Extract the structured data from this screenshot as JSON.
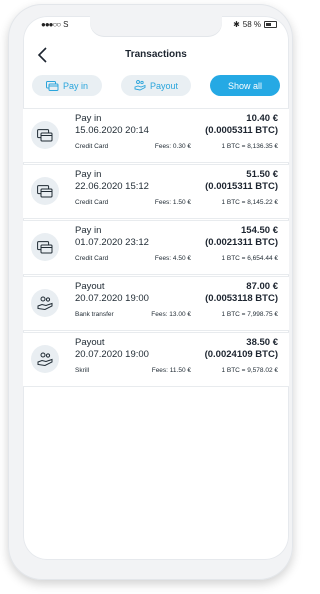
{
  "status": {
    "left": "S",
    "bluetooth": "✱",
    "battery": "58 %"
  },
  "header": {
    "title": "Transactions"
  },
  "tabs": [
    {
      "label": "Pay in",
      "icon": "card-icon",
      "active": false
    },
    {
      "label": "Payout",
      "icon": "hand-coins-icon",
      "active": false
    },
    {
      "label": "Show all",
      "active": true
    }
  ],
  "transactions": [
    {
      "type": "Pay in",
      "date": "15.06.2020  20:14",
      "method": "Credit Card",
      "fees": "Fees: 0.30 €",
      "amount": "10.40 €",
      "btc": "(0.0005311 BTC)",
      "rate": "1 BTC = 8,136.35 €",
      "icon": "card-icon"
    },
    {
      "type": "Pay in",
      "date": "22.06.2020  15:12",
      "method": "Credit Card",
      "fees": "Fees: 1.50 €",
      "amount": "51.50 €",
      "btc": "(0.0015311 BTC)",
      "rate": "1 BTC = 8,145.22 €",
      "icon": "card-icon"
    },
    {
      "type": "Pay in",
      "date": "01.07.2020  23:12",
      "method": "Credit Card",
      "fees": "Fees: 4.50 €",
      "amount": "154.50 €",
      "btc": "(0.0021311 BTC)",
      "rate": "1 BTC = 6,654.44 €",
      "icon": "card-icon"
    },
    {
      "type": "Payout",
      "date": "20.07.2020  19:00",
      "method": "Bank transfer",
      "fees": "Fees: 13.00 €",
      "amount": "87.00 €",
      "btc": "(0.0053118 BTC)",
      "rate": "1 BTC = 7,998.75 €",
      "icon": "hand-coins-icon"
    },
    {
      "type": "Payout",
      "date": "20.07.2020  19:00",
      "method": "Skrill",
      "fees": "Fees: 11.50 €",
      "amount": "38.50 €",
      "btc": "(0.0024109 BTC)",
      "rate": "1 BTC = 9,578.02 €",
      "icon": "hand-coins-icon"
    }
  ],
  "colors": {
    "accent": "#25a9e4",
    "tab_bg": "#e9eff3",
    "icon_bg": "#e9eef2"
  }
}
